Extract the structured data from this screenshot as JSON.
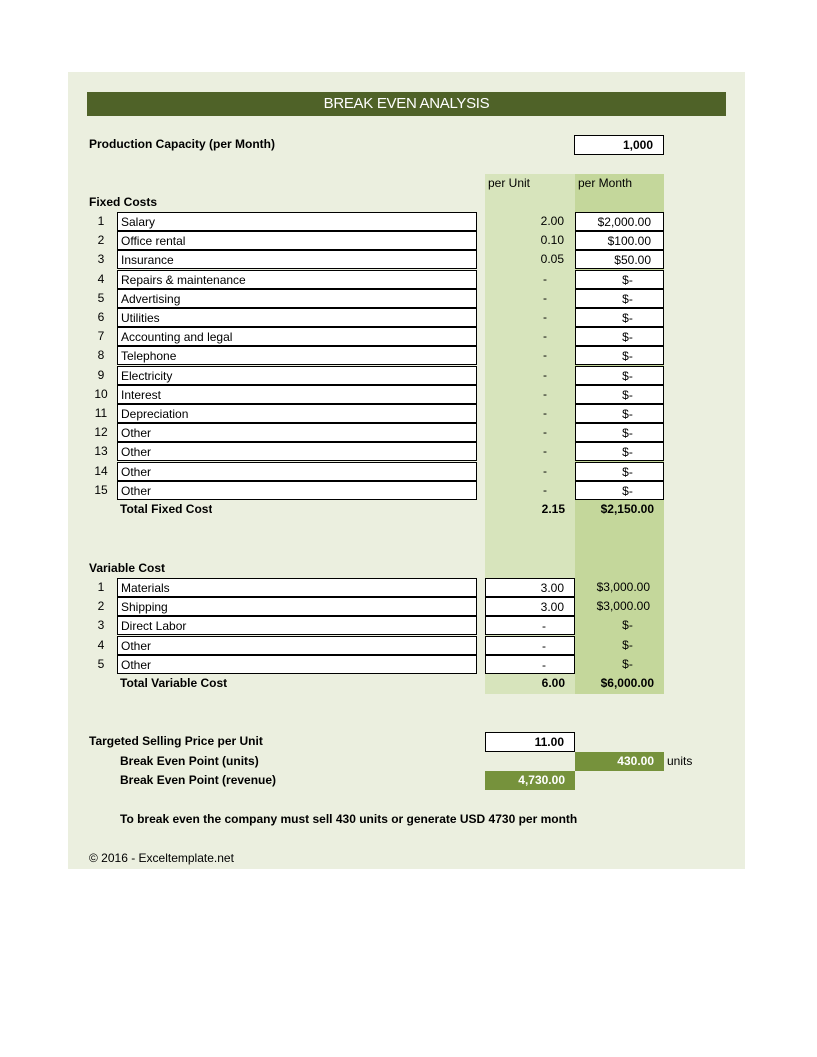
{
  "title": "BREAK EVEN ANALYSIS",
  "production_capacity": {
    "label": "Production Capacity (per Month)",
    "value": "1,000"
  },
  "columns": {
    "per_unit": "per Unit",
    "per_month": "per Month"
  },
  "fixed_costs": {
    "heading": "Fixed Costs",
    "items": [
      {
        "n": "1",
        "name": "Salary",
        "per_unit": "2.00",
        "per_month": "$2,000.00"
      },
      {
        "n": "2",
        "name": "Office rental",
        "per_unit": "0.10",
        "per_month": "$100.00"
      },
      {
        "n": "3",
        "name": "Insurance",
        "per_unit": "0.05",
        "per_month": "$50.00"
      },
      {
        "n": "4",
        "name": "Repairs & maintenance",
        "per_unit": "-",
        "per_month": "$-"
      },
      {
        "n": "5",
        "name": "Advertising",
        "per_unit": "-",
        "per_month": "$-"
      },
      {
        "n": "6",
        "name": "Utilities",
        "per_unit": "-",
        "per_month": "$-"
      },
      {
        "n": "7",
        "name": "Accounting and legal",
        "per_unit": "-",
        "per_month": "$-"
      },
      {
        "n": "8",
        "name": "Telephone",
        "per_unit": "-",
        "per_month": "$-"
      },
      {
        "n": "9",
        "name": "Electricity",
        "per_unit": "-",
        "per_month": "$-"
      },
      {
        "n": "10",
        "name": "Interest",
        "per_unit": "-",
        "per_month": "$-"
      },
      {
        "n": "11",
        "name": "Depreciation",
        "per_unit": "-",
        "per_month": "$-"
      },
      {
        "n": "12",
        "name": "Other",
        "per_unit": "-",
        "per_month": "$-"
      },
      {
        "n": "13",
        "name": "Other",
        "per_unit": "-",
        "per_month": "$-"
      },
      {
        "n": "14",
        "name": "Other",
        "per_unit": "-",
        "per_month": "$-"
      },
      {
        "n": "15",
        "name": "Other",
        "per_unit": "-",
        "per_month": "$-"
      }
    ],
    "total": {
      "label": "Total Fixed Cost",
      "per_unit": "2.15",
      "per_month": "$2,150.00"
    }
  },
  "variable_costs": {
    "heading": "Variable Cost",
    "items": [
      {
        "n": "1",
        "name": "Materials",
        "per_unit": "3.00",
        "per_month": "$3,000.00"
      },
      {
        "n": "2",
        "name": "Shipping",
        "per_unit": "3.00",
        "per_month": "$3,000.00"
      },
      {
        "n": "3",
        "name": "Direct Labor",
        "per_unit": "-",
        "per_month": "$-"
      },
      {
        "n": "4",
        "name": "Other",
        "per_unit": "-",
        "per_month": "$-"
      },
      {
        "n": "5",
        "name": "Other",
        "per_unit": "-",
        "per_month": "$-"
      }
    ],
    "total": {
      "label": "Total Variable Cost",
      "per_unit": "6.00",
      "per_month": "$6,000.00"
    }
  },
  "selling_price": {
    "label": "Targeted Selling Price per Unit",
    "value": "11.00"
  },
  "break_even_units": {
    "label": "Break Even Point (units)",
    "value": "430.00",
    "suffix": "units"
  },
  "break_even_revenue": {
    "label": "Break Even Point (revenue)",
    "value": "4,730.00"
  },
  "summary": "To break even the company must sell 430 units or generate USD 4730 per month",
  "footer": "© 2016 - Exceltemplate.net"
}
